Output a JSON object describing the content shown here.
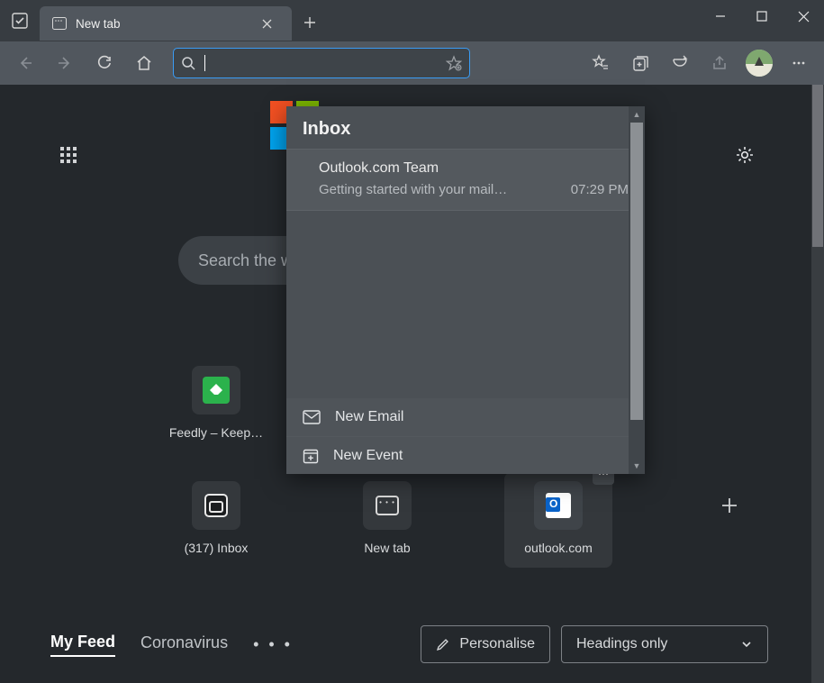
{
  "window": {
    "tab_title": "New tab"
  },
  "addressbar": {
    "value": "",
    "placeholder": ""
  },
  "ntp": {
    "search_placeholder": "Search the w",
    "tiles_row1": [
      {
        "label": "Feedly – Keep…"
      }
    ],
    "tiles_row2": [
      {
        "label": "(317) Inbox"
      },
      {
        "label": "New tab"
      },
      {
        "label": "outlook.com"
      }
    ]
  },
  "flyout": {
    "title": "Inbox",
    "message": {
      "sender": "Outlook.com Team",
      "preview": "Getting started with your mail…",
      "time": "07:29 PM"
    },
    "actions": {
      "new_email": "New Email",
      "new_event": "New Event"
    }
  },
  "feed": {
    "tab_myfeed": "My Feed",
    "tab_corona": "Coronavirus",
    "personalise": "Personalise",
    "headings": "Headings only"
  }
}
